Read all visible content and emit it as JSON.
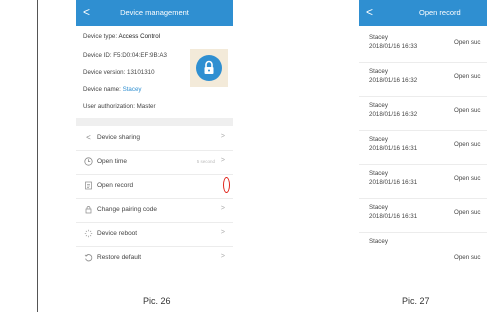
{
  "left_screen": {
    "title": "Device management",
    "back": "<",
    "device_type_label": "Device type:",
    "device_type_value": "Access Control",
    "device_id": "Device ID: F5:D0:04:EF:9B:A3",
    "device_version": "Device version: 13101310",
    "device_name_label": "Device name:",
    "device_name_value": "Stacey",
    "user_authorization": "User authorization: Master",
    "menu": [
      {
        "label": "Device sharing",
        "icon": "share-icon",
        "chevron": ">"
      },
      {
        "label": "Open time",
        "icon": "clock-icon",
        "chevron": ">",
        "extra": "5 second"
      },
      {
        "label": "Open record",
        "icon": "record-icon",
        "chevron": ""
      },
      {
        "label": "Change pairing code",
        "icon": "lock-icon",
        "chevron": ">"
      },
      {
        "label": "Device reboot",
        "icon": "reboot-icon",
        "chevron": ">"
      },
      {
        "label": "Restore default",
        "icon": "restore-icon",
        "chevron": ">"
      }
    ],
    "caption": "Pic. 26"
  },
  "right_screen": {
    "title": "Open record",
    "back": "<",
    "records": [
      {
        "name": "Stacey",
        "date": "2018/01/16 16:33",
        "status": "Open suc"
      },
      {
        "name": "Stacey",
        "date": "2018/01/16 16:32",
        "status": "Open suc"
      },
      {
        "name": "Stacey",
        "date": "2018/01/16 16:32",
        "status": "Open suc"
      },
      {
        "name": "Stacey",
        "date": "2018/01/16 16:31",
        "status": "Open suc"
      },
      {
        "name": "Stacey",
        "date": "2018/01/16 16:31",
        "status": "Open suc"
      },
      {
        "name": "Stacey",
        "date": "2018/01/16 16:31",
        "status": "Open suc"
      },
      {
        "name": "Stacey",
        "date": "",
        "status": "Open suc"
      }
    ],
    "caption": "Pic. 27"
  },
  "colors": {
    "accent": "#2f8fd1",
    "highlight": "#e0241b",
    "lock_bg": "#f3ead9"
  }
}
